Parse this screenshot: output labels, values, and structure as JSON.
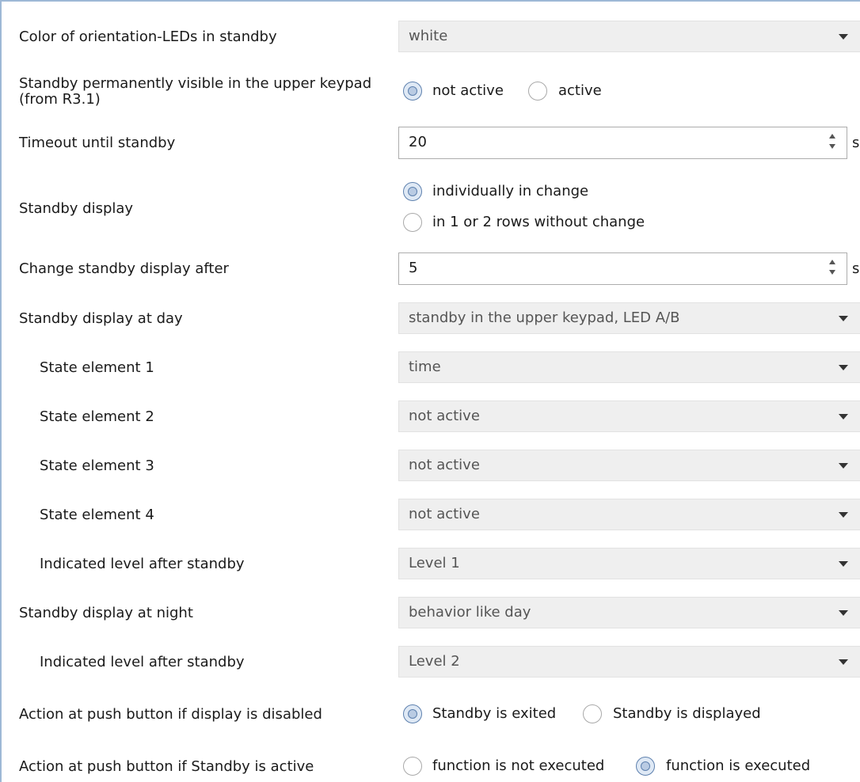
{
  "rows": {
    "color_leds": {
      "label": "Color of orientation-LEDs in standby",
      "value": "white"
    },
    "standby_visible": {
      "label_line1": "Standby permanently visible in the upper keypad",
      "label_line2": "(from R3.1)",
      "options": [
        "not active",
        "active"
      ],
      "selected": "not active"
    },
    "timeout": {
      "label": "Timeout until standby",
      "value": "20",
      "unit": "s"
    },
    "standby_display": {
      "label": "Standby display",
      "options": [
        "individually in change",
        "in 1 or 2 rows without change"
      ],
      "selected": "individually in change"
    },
    "change_after": {
      "label": "Change standby display after",
      "value": "5",
      "unit": "s"
    },
    "display_day": {
      "label": "Standby display at day",
      "value": "standby in the upper keypad, LED A/B"
    },
    "state1": {
      "label": "State element 1",
      "value": "time"
    },
    "state2": {
      "label": "State element 2",
      "value": "not active"
    },
    "state3": {
      "label": "State element 3",
      "value": "not active"
    },
    "state4": {
      "label": "State element 4",
      "value": "not active"
    },
    "level_day": {
      "label": "Indicated level after standby",
      "value": "Level 1"
    },
    "display_night": {
      "label": "Standby display at night",
      "value": "behavior like day"
    },
    "level_night": {
      "label": "Indicated level after standby",
      "value": "Level 2"
    },
    "action_disabled": {
      "label": "Action at push button if display is disabled",
      "options": [
        "Standby is exited",
        "Standby is displayed"
      ],
      "selected": "Standby is exited"
    },
    "action_active": {
      "label": "Action at push button if Standby is active",
      "options": [
        "function is not executed",
        "function is executed"
      ],
      "selected": "function is executed"
    }
  },
  "colors": {
    "radio_selected": "#5d80ae",
    "dropdown_bg": "#efefef",
    "frame": "#9eb8d6"
  }
}
